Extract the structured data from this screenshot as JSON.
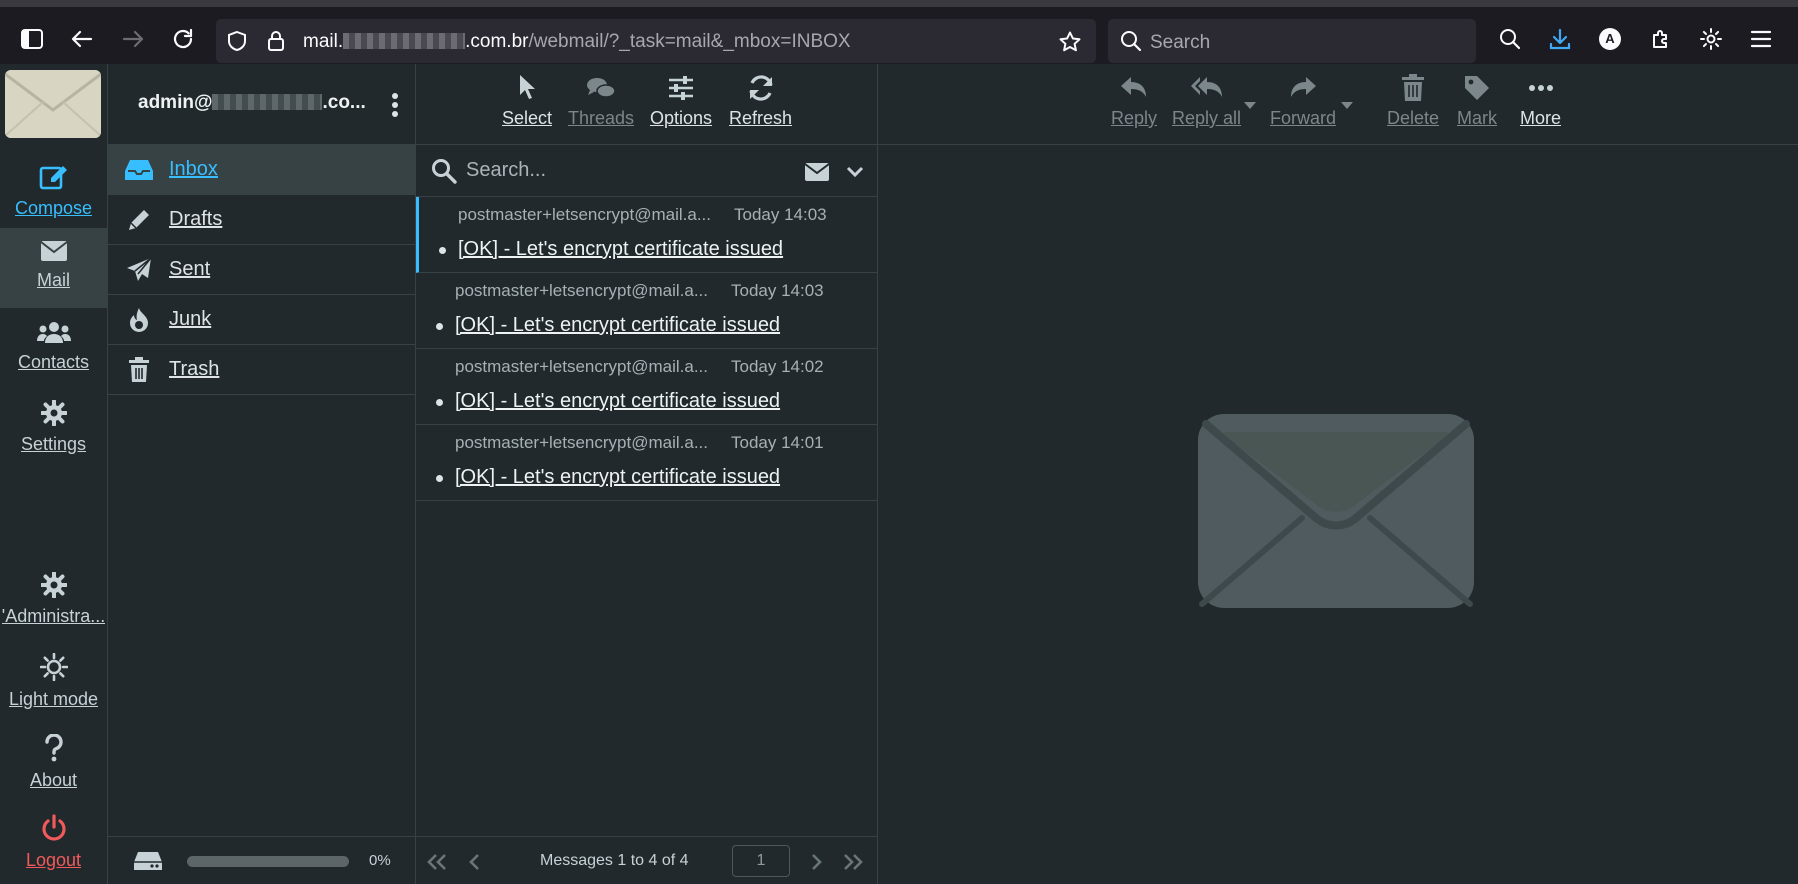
{
  "browser": {
    "url_prefix": "mail.",
    "url_domain_suffix": ".com.br",
    "url_path": "/webmail/?_task=mail&_mbox=INBOX",
    "search_placeholder": "Search",
    "profile_letter": "A"
  },
  "taskmenu": {
    "compose": "Compose",
    "mail": "Mail",
    "contacts": "Contacts",
    "settings": "Settings",
    "admin": "'Administra...",
    "light_mode": "Light mode",
    "about": "About",
    "logout": "Logout"
  },
  "folders": {
    "account_prefix": "admin@",
    "account_suffix": ".co...",
    "items": [
      {
        "label": "Inbox",
        "icon": "inbox-icon"
      },
      {
        "label": "Drafts",
        "icon": "pencil-icon"
      },
      {
        "label": "Sent",
        "icon": "paper-plane-icon"
      },
      {
        "label": "Junk",
        "icon": "fire-icon"
      },
      {
        "label": "Trash",
        "icon": "trash-icon"
      }
    ],
    "quota_text": "0%"
  },
  "list_toolbar": {
    "select": "Select",
    "threads": "Threads",
    "options": "Options",
    "refresh": "Refresh"
  },
  "list": {
    "search_placeholder": "Search...",
    "messages": [
      {
        "from": "postmaster+letsencrypt@mail.a...",
        "date": "Today 14:03",
        "subject": "[OK] - Let's encrypt certificate issued"
      },
      {
        "from": "postmaster+letsencrypt@mail.a...",
        "date": "Today 14:03",
        "subject": "[OK] - Let's encrypt certificate issued"
      },
      {
        "from": "postmaster+letsencrypt@mail.a...",
        "date": "Today 14:02",
        "subject": "[OK] - Let's encrypt certificate issued"
      },
      {
        "from": "postmaster+letsencrypt@mail.a...",
        "date": "Today 14:01",
        "subject": "[OK] - Let's encrypt certificate issued"
      }
    ],
    "pager_text": "Messages 1 to 4 of 4",
    "page": "1"
  },
  "preview_toolbar": {
    "reply": "Reply",
    "reply_all": "Reply all",
    "forward": "Forward",
    "delete": "Delete",
    "mark": "Mark",
    "more": "More"
  },
  "colors": {
    "accent": "#37beff",
    "background": "#21292c",
    "border": "#374245",
    "logout": "#f15a5a"
  }
}
